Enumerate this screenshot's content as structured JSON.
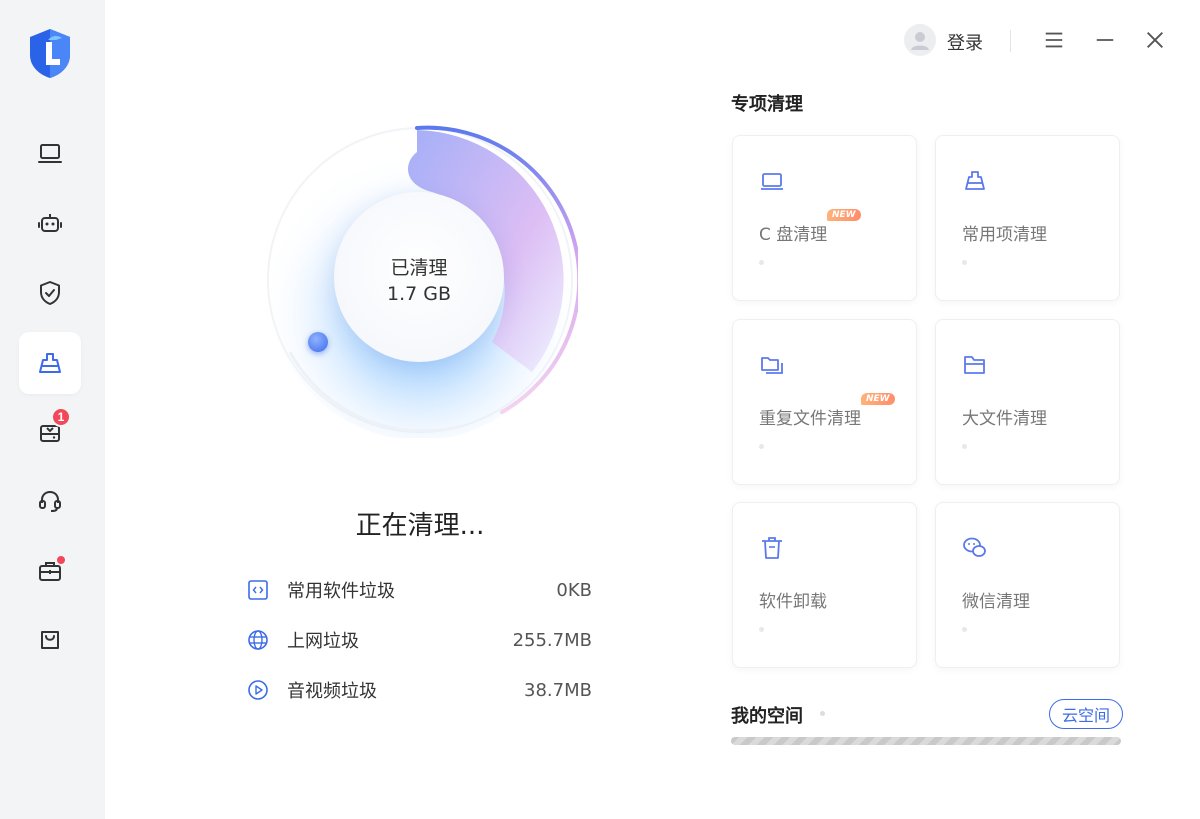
{
  "colors": {
    "accent": "#3d6bea",
    "badge": "#f2495a",
    "sidebar_bg": "#f3f4f6"
  },
  "sidebar": {
    "logo_icon": "shield-L-logo-icon",
    "items": [
      {
        "icon": "monitor-icon"
      },
      {
        "icon": "robot-icon"
      },
      {
        "icon": "shield-check-icon"
      },
      {
        "icon": "broom-clean-icon",
        "active": true
      },
      {
        "icon": "disk-download-icon",
        "badge": "1"
      },
      {
        "icon": "headset-icon"
      },
      {
        "icon": "toolbox-icon"
      },
      {
        "icon": "shopping-bag-icon"
      }
    ]
  },
  "topbar": {
    "login_label": "登录"
  },
  "progress": {
    "center_label": "已清理",
    "center_value": "1.7 GB"
  },
  "status": {
    "title": "正在清理..."
  },
  "junk_list": [
    {
      "name": "常用软件垃圾",
      "size": "0KB",
      "icon": "code-file-icon"
    },
    {
      "name": "上网垃圾",
      "size": "255.7MB",
      "icon": "globe-icon"
    },
    {
      "name": "音视频垃圾",
      "size": "38.7MB",
      "icon": "play-circle-icon"
    }
  ],
  "special": {
    "title": "专项清理",
    "cards": [
      {
        "label": "C 盘清理",
        "badge": "NEW",
        "icon": "disk-icon"
      },
      {
        "label": "常用项清理",
        "icon": "broom-icon"
      },
      {
        "label": "重复文件清理",
        "badge": "NEW",
        "icon": "duplicate-folder-icon"
      },
      {
        "label": "大文件清理",
        "icon": "folder-icon"
      },
      {
        "label": "软件卸载",
        "icon": "trash-icon"
      },
      {
        "label": "微信清理",
        "icon": "wechat-icon"
      }
    ]
  },
  "my_space": {
    "title": "我的空间",
    "cloud_button": "云空间"
  }
}
